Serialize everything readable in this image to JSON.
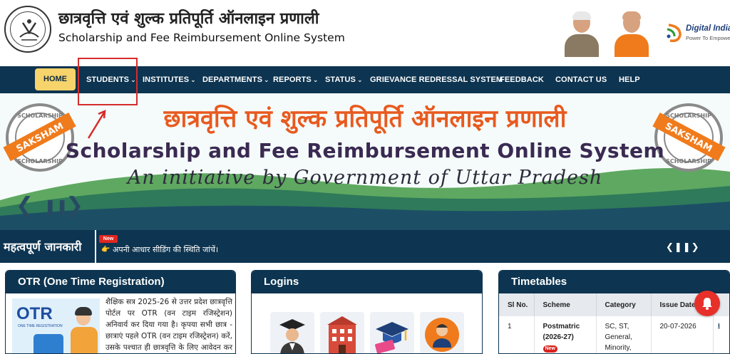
{
  "header": {
    "title_hindi": "छात्रवृत्ति एवं शुल्क प्रतिपूर्ति ऑनलाइन प्रणाली",
    "title_english": "Scholarship and Fee Reimbursement Online System",
    "digital_india": {
      "title": "Digital India",
      "tagline": "Power To Empower"
    }
  },
  "nav": {
    "items": [
      {
        "label": "HOME"
      },
      {
        "label": "STUDENTS",
        "has_dropdown": true
      },
      {
        "label": "INSTITUTES",
        "has_dropdown": true
      },
      {
        "label": "DEPARTMENTS",
        "has_dropdown": true
      },
      {
        "label": "REPORTS",
        "has_dropdown": true
      },
      {
        "label": "STATUS",
        "has_dropdown": true
      },
      {
        "label": "GRIEVANCE REDRESSAL SYSTEM"
      },
      {
        "label": "FEEDBACK"
      },
      {
        "label": "CONTACT US"
      },
      {
        "label": "HELP"
      }
    ],
    "chevron": "⌄"
  },
  "banner": {
    "title_hindi": "छात्रवृत्ति एवं शुल्क प्रतिपूर्ति ऑनलाइन प्रणाली",
    "title_english": "Scholarship and Fee Reimbursement Online System",
    "subtitle": "An initiative by Government of Uttar Pradesh",
    "seal_top": "SCHOLARSHIP",
    "seal_mid": "SAKSHAM",
    "seal_bottom": "SCHOLARSHIP",
    "controls": {
      "prev": "❮",
      "pause": "❚❚",
      "next": "❯"
    }
  },
  "important_info": {
    "title": "महत्वपूर्ण जानकारी",
    "badge": "New",
    "icon": "👉",
    "text": "अपनी आधार सीडिंग की स्थिति जांचें।",
    "controls": "❮❚❚❯"
  },
  "otr": {
    "title": "OTR (One Time Registration)",
    "image_big": "OTR",
    "image_small": "ONE TIME REGISTRATION",
    "text": "शैक्षिक सत्र 2025-26 से उत्तर प्रदेश छात्रवृत्ति पोर्टल पर OTR (वन टाइम रजिस्ट्रेशन) अनिवार्य कर दिया गया है। कृपया सभी छात्र - छात्राएं पहले OTR (वन टाइम रजिस्ट्रेशन) करें, उसके पश्चात ही छात्रवृत्ति के लिए आवेदन कर सकेंगे।"
  },
  "logins": {
    "title": "Logins",
    "tiles": [
      {
        "icon": "graduate-icon"
      },
      {
        "icon": "institute-building-icon"
      },
      {
        "icon": "graduation-cap-icon"
      },
      {
        "icon": "officer-icon"
      }
    ]
  },
  "timetables": {
    "title": "Timetables",
    "columns": [
      "Sl No.",
      "Scheme",
      "Category",
      "Issue Date"
    ],
    "rows": [
      {
        "sl": "1",
        "scheme": "Postmatric (2026-27)",
        "badge": "New",
        "category": "SC, ST, General, Minority,",
        "issue_date": "20-07-2026",
        "action_icon": "download-icon"
      }
    ]
  },
  "notification_bell": {
    "icon": "bell-icon"
  }
}
